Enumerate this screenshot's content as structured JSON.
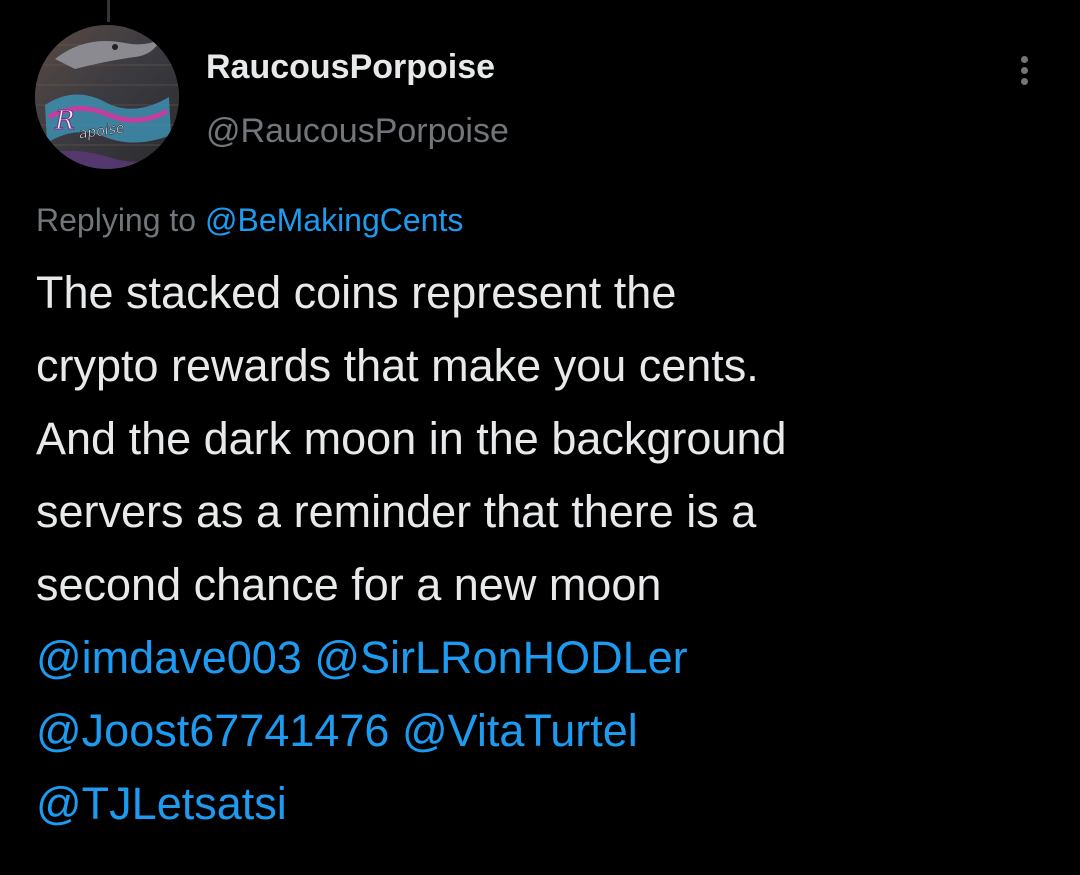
{
  "author": {
    "display_name": "RaucousPorpoise",
    "handle": "@RaucousPorpoise"
  },
  "reply": {
    "prefix": "Replying to ",
    "to_handle": "@BeMakingCents"
  },
  "tweet": {
    "lines": [
      "The stacked coins represent the",
      "crypto rewards that make you cents.",
      "And the dark moon in the background",
      "servers as a reminder that there is a",
      "second chance for a new moon"
    ],
    "mentions": [
      "@imdave003",
      "@SirLRonHODLer",
      "@Joost67741476",
      "@VitaTurtel",
      "@TJLetsatsi"
    ]
  },
  "icons": {
    "more": "more-vertical-icon",
    "avatar": "avatar-image"
  },
  "colors": {
    "background": "#000000",
    "text": "#e7e9ea",
    "secondary": "#71767b",
    "link": "#1d9bf0"
  }
}
